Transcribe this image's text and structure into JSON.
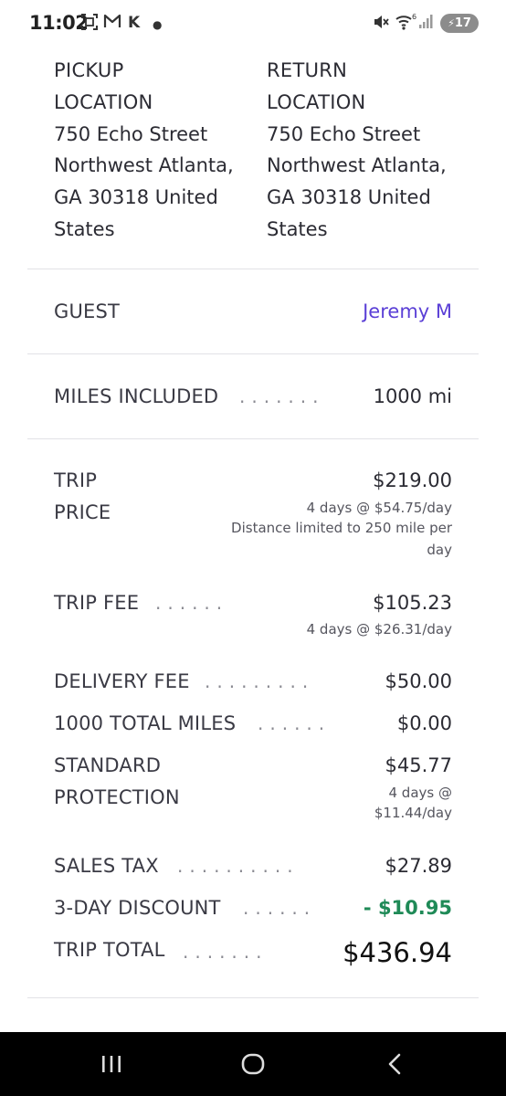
{
  "status_bar": {
    "time": "11:02",
    "notification_icons": [
      "scan-icon",
      "gmail-icon",
      "k-icon",
      "dot-icon"
    ],
    "system_icons": [
      "mute-icon",
      "wifi-6-icon",
      "signal-icon"
    ],
    "battery": "17"
  },
  "locations": {
    "pickup": {
      "label_line1": "PICKUP",
      "label_line2": "LOCATION",
      "address": [
        "750 Echo Street",
        "Northwest Atlanta,",
        "GA 30318 United",
        "States"
      ]
    },
    "return": {
      "label_line1": "RETURN",
      "label_line2": "LOCATION",
      "address": [
        "750 Echo Street",
        "Northwest Atlanta,",
        "GA 30318 United",
        "States"
      ]
    }
  },
  "guest": {
    "label": "GUEST",
    "name": "Jeremy M"
  },
  "miles": {
    "label": "MILES INCLUDED",
    "value": "1000 mi"
  },
  "trip_price": {
    "label_line1": "TRIP",
    "label_line2": "PRICE",
    "value": "$219.00",
    "detail_line1": "4 days @ $54.75/day",
    "detail_line2": "Distance limited to 250 mile per",
    "detail_line3": "day"
  },
  "trip_fee": {
    "label": "TRIP FEE",
    "value": "$105.23",
    "detail": "4 days @ $26.31/day"
  },
  "delivery_fee": {
    "label": "DELIVERY FEE",
    "value": "$50.00"
  },
  "total_miles": {
    "label": "1000 TOTAL MILES",
    "value": "$0.00"
  },
  "protection": {
    "label_line1": "STANDARD",
    "label_line2": "PROTECTION",
    "value": "$45.77",
    "detail_line1": "4 days @",
    "detail_line2": "$11.44/day"
  },
  "sales_tax": {
    "label": "SALES TAX",
    "value": "$27.89"
  },
  "discount": {
    "label": "3-DAY DISCOUNT",
    "value": "- $10.95",
    "color": "#1f8a57"
  },
  "trip_total": {
    "label": "TRIP TOTAL",
    "value": "$436.94"
  },
  "colors": {
    "accent": "#5a3fd6",
    "discount": "#1f8a57",
    "nav_bar": "#000000"
  },
  "nav": {
    "buttons": [
      "recent-apps-icon",
      "home-icon",
      "back-icon"
    ]
  }
}
